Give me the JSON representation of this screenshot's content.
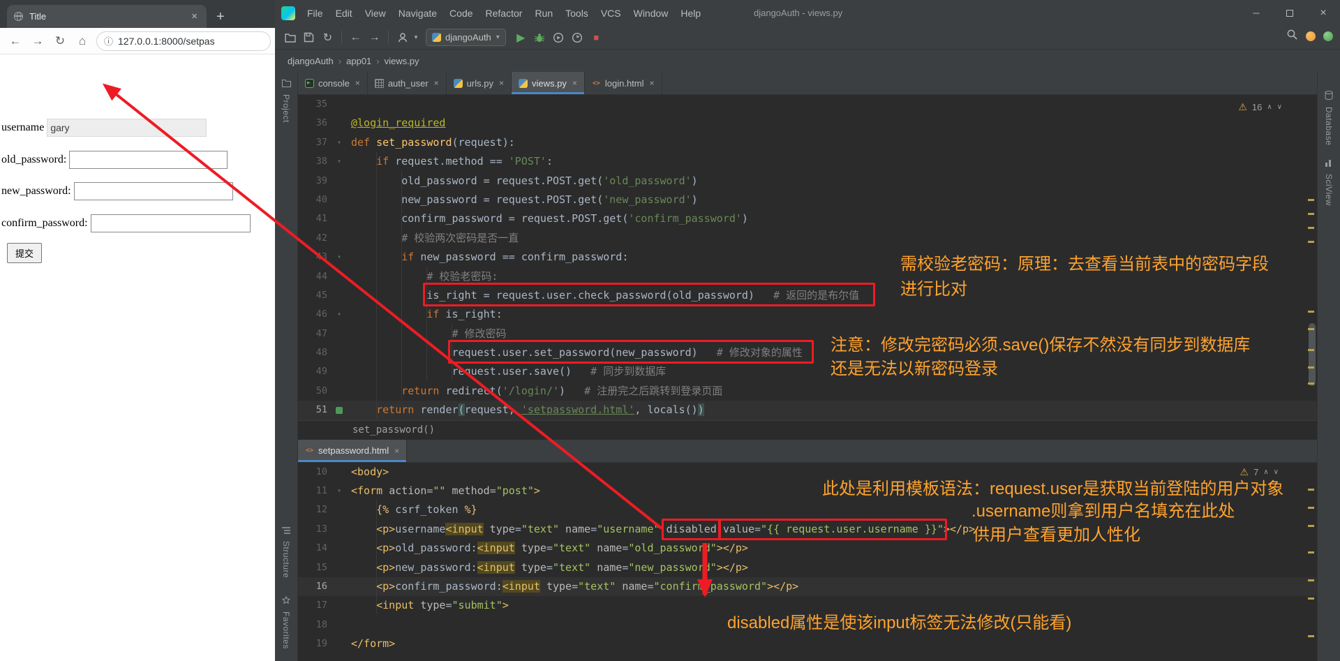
{
  "glyphs": {
    "back": "←",
    "forward": "→",
    "reload": "↻",
    "home": "⌂",
    "info": "ⓘ",
    "close": "×",
    "plus": "+",
    "caret": "▾",
    "run": "▶",
    "stop": "■",
    "minimize": "─",
    "warning": "⚠",
    "chev_up": "∧",
    "chev_down": "∨",
    "crumb_sep": "›",
    "fold": "▾"
  },
  "browser": {
    "tab_title": "Title",
    "url": "127.0.0.1:8000/setpas",
    "form": {
      "username_label": "username",
      "username_value": "gary",
      "old_label": "old_password:",
      "new_label": "new_password:",
      "confirm_label": "confirm_password:",
      "submit": "提交"
    }
  },
  "ide": {
    "menu": [
      "File",
      "Edit",
      "View",
      "Navigate",
      "Code",
      "Refactor",
      "Run",
      "Tools",
      "VCS",
      "Window",
      "Help"
    ],
    "window_title": "djangoAuth - views.py",
    "run_config": "djangoAuth",
    "breadcrumbs": [
      "djangoAuth",
      "app01",
      "views.py"
    ],
    "stripes": {
      "left_top": "Project",
      "left_bottom": [
        "Structure",
        "Favorites"
      ],
      "right_top": [
        "Database",
        "SciView"
      ]
    },
    "inspections_top": "16",
    "inspections_bottom": "7",
    "context_line": "set_password()",
    "tabs": [
      {
        "label": "console",
        "icon": "console",
        "active": false
      },
      {
        "label": "auth_user",
        "icon": "table",
        "active": false
      },
      {
        "label": "urls.py",
        "icon": "py",
        "active": false
      },
      {
        "label": "views.py",
        "icon": "py",
        "active": true
      },
      {
        "label": "login.html",
        "icon": "html",
        "active": false
      }
    ],
    "editor_top": {
      "lines": [
        {
          "n": 35,
          "tok": []
        },
        {
          "n": 36,
          "tok": [
            {
              "t": "@login_required",
              "c": "dec u"
            }
          ]
        },
        {
          "n": 37,
          "fold": true,
          "tok": [
            {
              "t": "def ",
              "c": "kw"
            },
            {
              "t": "set_password",
              "c": "fn"
            },
            {
              "t": "(request):",
              "c": "pl"
            }
          ]
        },
        {
          "n": 38,
          "fold": true,
          "tok": [
            {
              "t": "    ",
              "c": "pl"
            },
            {
              "t": "if ",
              "c": "kw"
            },
            {
              "t": "request.method == ",
              "c": "pl"
            },
            {
              "t": "'POST'",
              "c": "str"
            },
            {
              "t": ":",
              "c": "pl"
            }
          ]
        },
        {
          "n": 39,
          "tok": [
            {
              "t": "        old_password = request.POST.get(",
              "c": "pl"
            },
            {
              "t": "'old_password'",
              "c": "str"
            },
            {
              "t": ")",
              "c": "pl"
            }
          ]
        },
        {
          "n": 40,
          "tok": [
            {
              "t": "        new_password = request.POST.get(",
              "c": "pl"
            },
            {
              "t": "'new_password'",
              "c": "str"
            },
            {
              "t": ")",
              "c": "pl"
            }
          ]
        },
        {
          "n": 41,
          "tok": [
            {
              "t": "        confirm_password = request.POST.get(",
              "c": "pl"
            },
            {
              "t": "'confirm_password'",
              "c": "str"
            },
            {
              "t": ")",
              "c": "pl"
            }
          ]
        },
        {
          "n": 42,
          "tok": [
            {
              "t": "        ",
              "c": "pl"
            },
            {
              "t": "# 校验两次密码是否一直",
              "c": "cm"
            }
          ]
        },
        {
          "n": 43,
          "fold": true,
          "tok": [
            {
              "t": "        ",
              "c": "pl"
            },
            {
              "t": "if ",
              "c": "kw"
            },
            {
              "t": "new_password == confirm_password:",
              "c": "pl"
            }
          ]
        },
        {
          "n": 44,
          "tok": [
            {
              "t": "            ",
              "c": "pl"
            },
            {
              "t": "# 校验老密码:",
              "c": "cm"
            }
          ]
        },
        {
          "n": 45,
          "tok": [
            {
              "t": "            is_right = request.user.check_password(old_password)   ",
              "c": "pl"
            },
            {
              "t": "# 返回的是布尔值",
              "c": "cm"
            }
          ]
        },
        {
          "n": 46,
          "fold": true,
          "tok": [
            {
              "t": "            ",
              "c": "pl"
            },
            {
              "t": "if ",
              "c": "kw"
            },
            {
              "t": "is_right:",
              "c": "pl"
            }
          ]
        },
        {
          "n": 47,
          "tok": [
            {
              "t": "                ",
              "c": "pl"
            },
            {
              "t": "# 修改密码",
              "c": "cm"
            }
          ]
        },
        {
          "n": 48,
          "tok": [
            {
              "t": "                request.user.set_password(new_password)   ",
              "c": "pl"
            },
            {
              "t": "# 修改对象的属性",
              "c": "cm"
            }
          ]
        },
        {
          "n": 49,
          "tok": [
            {
              "t": "                request.user.save()   ",
              "c": "pl"
            },
            {
              "t": "# 同步到数据库",
              "c": "cm"
            }
          ]
        },
        {
          "n": 50,
          "tok": [
            {
              "t": "        ",
              "c": "pl"
            },
            {
              "t": "return ",
              "c": "kw"
            },
            {
              "t": "redirect(",
              "c": "pl"
            },
            {
              "t": "'/login/'",
              "c": "str"
            },
            {
              "t": ")   ",
              "c": "pl"
            },
            {
              "t": "# 注册完之后跳转到登录页面",
              "c": "cm"
            }
          ]
        },
        {
          "n": 51,
          "cur": true,
          "gicon": true,
          "tok": [
            {
              "t": "    ",
              "c": "pl"
            },
            {
              "t": "return ",
              "c": "kw"
            },
            {
              "t": "render",
              "c": "pl"
            },
            {
              "t": "(",
              "c": "pl brc"
            },
            {
              "t": "request, ",
              "c": "pl"
            },
            {
              "t": "'setpassword.html'",
              "c": "str u"
            },
            {
              "t": ", locals()",
              "c": "pl"
            },
            {
              "t": ")",
              "c": "pl brc"
            }
          ]
        }
      ]
    },
    "editor_bottom": {
      "tab": "setpassword.html",
      "lines": [
        {
          "n": 10,
          "tok": [
            {
              "t": "<body>",
              "c": "tag"
            }
          ]
        },
        {
          "n": 11,
          "fold": true,
          "tok": [
            {
              "t": "<form ",
              "c": "tag"
            },
            {
              "t": "action",
              "c": "att"
            },
            {
              "t": "=",
              "c": "pl"
            },
            {
              "t": "\"\"",
              "c": "val"
            },
            {
              "t": " ",
              "c": "pl"
            },
            {
              "t": "method",
              "c": "att"
            },
            {
              "t": "=",
              "c": "pl"
            },
            {
              "t": "\"post\"",
              "c": "val"
            },
            {
              "t": ">",
              "c": "tag"
            }
          ]
        },
        {
          "n": 12,
          "tok": [
            {
              "t": "    ",
              "c": "pl"
            },
            {
              "t": "{% ",
              "c": "dj"
            },
            {
              "t": "csrf_token",
              "c": "pl"
            },
            {
              "t": " %}",
              "c": "dj"
            }
          ]
        },
        {
          "n": 13,
          "tok": [
            {
              "t": "    ",
              "c": "pl"
            },
            {
              "t": "<p>",
              "c": "tag"
            },
            {
              "t": "username",
              "c": "txt"
            },
            {
              "t": "<input",
              "c": "tag hl"
            },
            {
              "t": " type",
              "c": "att"
            },
            {
              "t": "=",
              "c": "pl"
            },
            {
              "t": "\"text\"",
              "c": "val"
            },
            {
              "t": " name",
              "c": "att"
            },
            {
              "t": "=",
              "c": "pl"
            },
            {
              "t": "\"username\"",
              "c": "val"
            },
            {
              "t": " ",
              "c": "pl"
            },
            {
              "t": "disabled",
              "c": "att"
            },
            {
              "t": " value",
              "c": "att"
            },
            {
              "t": "=",
              "c": "pl"
            },
            {
              "t": "\"{{ request.user.username }}\"",
              "c": "val"
            },
            {
              "t": "></p>",
              "c": "tag"
            }
          ]
        },
        {
          "n": 14,
          "tok": [
            {
              "t": "    ",
              "c": "pl"
            },
            {
              "t": "<p>",
              "c": "tag"
            },
            {
              "t": "old_password:",
              "c": "txt"
            },
            {
              "t": "<input",
              "c": "tag hl"
            },
            {
              "t": " type",
              "c": "att"
            },
            {
              "t": "=",
              "c": "pl"
            },
            {
              "t": "\"text\"",
              "c": "val"
            },
            {
              "t": " name",
              "c": "att"
            },
            {
              "t": "=",
              "c": "pl"
            },
            {
              "t": "\"old_password\"",
              "c": "val"
            },
            {
              "t": "></p>",
              "c": "tag"
            }
          ]
        },
        {
          "n": 15,
          "tok": [
            {
              "t": "    ",
              "c": "pl"
            },
            {
              "t": "<p>",
              "c": "tag"
            },
            {
              "t": "new_password:",
              "c": "txt"
            },
            {
              "t": "<input",
              "c": "tag hl"
            },
            {
              "t": " type",
              "c": "att"
            },
            {
              "t": "=",
              "c": "pl"
            },
            {
              "t": "\"text\"",
              "c": "val"
            },
            {
              "t": " name",
              "c": "att"
            },
            {
              "t": "=",
              "c": "pl"
            },
            {
              "t": "\"new_password\"",
              "c": "val"
            },
            {
              "t": "></p>",
              "c": "tag"
            }
          ]
        },
        {
          "n": 16,
          "cur": true,
          "tok": [
            {
              "t": "    ",
              "c": "pl"
            },
            {
              "t": "<p>",
              "c": "tag"
            },
            {
              "t": "confirm_password:",
              "c": "txt"
            },
            {
              "t": "<input",
              "c": "tag hl"
            },
            {
              "t": " type",
              "c": "att"
            },
            {
              "t": "=",
              "c": "pl"
            },
            {
              "t": "\"text\"",
              "c": "val"
            },
            {
              "t": " name",
              "c": "att"
            },
            {
              "t": "=",
              "c": "pl"
            },
            {
              "t": "\"confirm_password\"",
              "c": "val"
            },
            {
              "t": "></p>",
              "c": "tag"
            }
          ]
        },
        {
          "n": 17,
          "tok": [
            {
              "t": "    ",
              "c": "pl"
            },
            {
              "t": "<input",
              "c": "tag"
            },
            {
              "t": " type",
              "c": "att"
            },
            {
              "t": "=",
              "c": "pl"
            },
            {
              "t": "\"submit\"",
              "c": "val"
            },
            {
              "t": ">",
              "c": "tag"
            }
          ]
        },
        {
          "n": 18,
          "tok": []
        },
        {
          "n": 19,
          "tok": [
            {
              "t": "</form>",
              "c": "tag"
            }
          ]
        }
      ]
    }
  },
  "annotations": {
    "note1a": "需校验老密码：原理：去查看当前表中的密码字段",
    "note1b": "进行比对",
    "note2a": "注意：修改完密码必须.save()保存不然没有同步到数据库",
    "note2b": "还是无法以新密码登录",
    "note3a": "此处是利用模板语法：request.user是获取当前登陆的用户对象",
    "note3b": ".username则拿到用户名填充在此处",
    "note3c": "供用户查看更加人性化",
    "note4": "disabled属性是使该input标签无法修改(只能看)"
  }
}
